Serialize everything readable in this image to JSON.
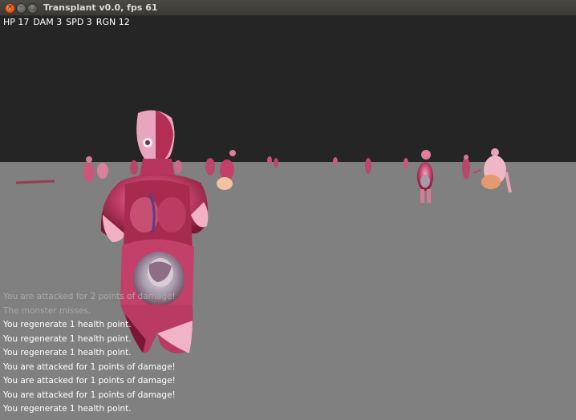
{
  "window": {
    "title": "Transplant v0.0, fps 61"
  },
  "hud": {
    "hp": "HP 17",
    "dam": "DAM 3",
    "spd": "SPD 3",
    "rgn": "RGN 12"
  },
  "message_log": [
    {
      "text": "You are attacked for 2 points of damage!",
      "faded": true
    },
    {
      "text": "The monster misses.",
      "faded": true
    },
    {
      "text": "You regenerate 1 health point.",
      "faded": false
    },
    {
      "text": "You regenerate 1 health point.",
      "faded": false
    },
    {
      "text": "You regenerate 1 health point.",
      "faded": false
    },
    {
      "text": "You are attacked for 1 points of damage!",
      "faded": false
    },
    {
      "text": "You are attacked for 1 points of damage!",
      "faded": false
    },
    {
      "text": "You are attacked for 1 points of damage!",
      "faded": false
    },
    {
      "text": "You regenerate 1 health point.",
      "faded": false
    }
  ],
  "colors": {
    "ceiling": "#252525",
    "floor": "#808080",
    "flesh": "#c2406a",
    "skin": "#e79ab6"
  }
}
